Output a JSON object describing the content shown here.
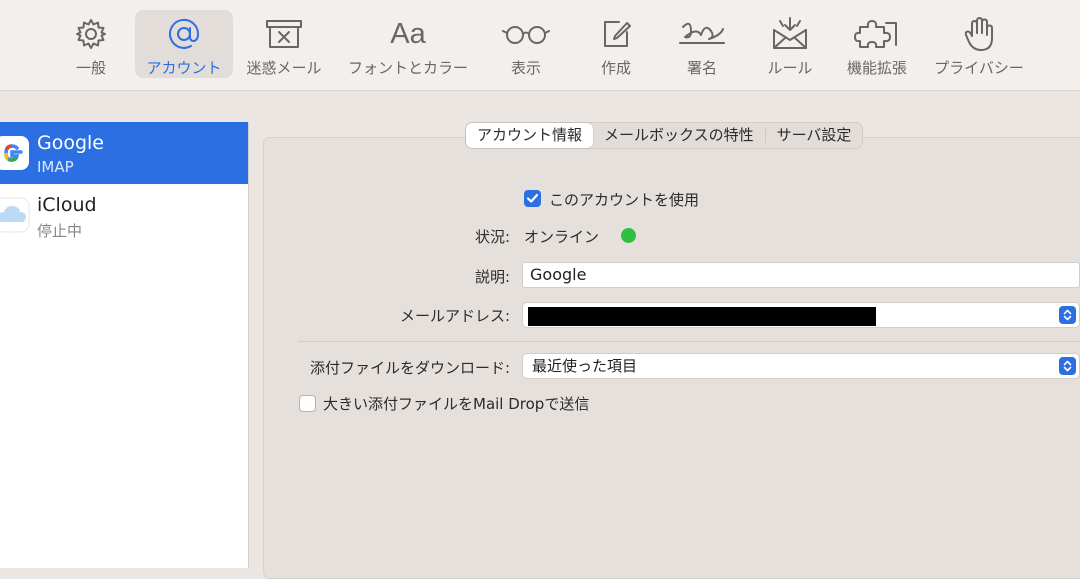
{
  "toolbar": {
    "items": [
      {
        "label": "一般",
        "icon": "gear-icon"
      },
      {
        "label": "アカウント",
        "icon": "at-sign-icon",
        "active": true
      },
      {
        "label": "迷惑メール",
        "icon": "junk-box-icon"
      },
      {
        "label": "フォントとカラー",
        "icon": "font-aa-icon",
        "glyph": "Aa"
      },
      {
        "label": "表示",
        "icon": "glasses-icon"
      },
      {
        "label": "作成",
        "icon": "compose-icon"
      },
      {
        "label": "署名",
        "icon": "signature-icon"
      },
      {
        "label": "ルール",
        "icon": "rules-envelope-icon"
      },
      {
        "label": "機能拡張",
        "icon": "puzzle-icon"
      },
      {
        "label": "プライバシー",
        "icon": "hand-icon"
      }
    ]
  },
  "sidebar": {
    "accounts": [
      {
        "name": "Google",
        "status": "IMAP",
        "icon": "google-icon",
        "selected": true
      },
      {
        "name": "iCloud",
        "status": "停止中",
        "icon": "icloud-icon",
        "selected": false
      }
    ]
  },
  "tabs": {
    "account_info": "アカウント情報",
    "mailbox_behaviors": "メールボックスの特性",
    "server_settings": "サーバ設定",
    "active": "account_info"
  },
  "form": {
    "use_account_label": "このアカウントを使用",
    "use_account_checked": true,
    "status_label": "状況:",
    "status_value": "オンライン",
    "status_color": "#2ec040",
    "description_label": "説明:",
    "description_value": "Google",
    "email_label": "メールアドレス:",
    "download_label": "添付ファイルをダウンロード:",
    "download_value": "最近使った項目",
    "maildrop_label": "大きい添付ファイルをMail Dropで送信",
    "maildrop_checked": false
  },
  "colors": {
    "accent": "#2b6fe3",
    "toolbar_bg": "#f3efec",
    "panel_bg": "#e5e0dc"
  }
}
